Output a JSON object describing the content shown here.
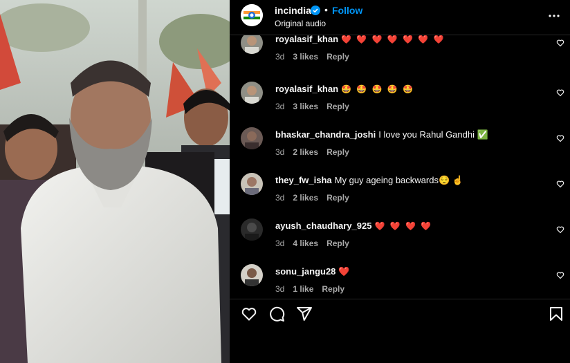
{
  "header": {
    "username": "incindia",
    "follow_label": "Follow",
    "separator": "•",
    "audio_label": "Original audio"
  },
  "comments": [
    {
      "username": "royalasif_khan",
      "text": "❤️ ❤️ ❤️ ❤️ ❤️ ❤️ ❤️",
      "time": "3d",
      "likes": "3 likes",
      "reply": "Reply"
    },
    {
      "username": "royalasif_khan",
      "text": "🤩 🤩 🤩 🤩 🤩",
      "time": "3d",
      "likes": "3 likes",
      "reply": "Reply"
    },
    {
      "username": "bhaskar_chandra_joshi",
      "text": "I love you Rahul Gandhi ✅",
      "time": "3d",
      "likes": "2 likes",
      "reply": "Reply"
    },
    {
      "username": "they_fw_isha",
      "text": "My guy ageing backwards😌 ☝️",
      "time": "3d",
      "likes": "2 likes",
      "reply": "Reply"
    },
    {
      "username": "ayush_chaudhary_925",
      "text": "❤️ ❤️ ❤️ ❤️",
      "time": "3d",
      "likes": "4 likes",
      "reply": "Reply"
    },
    {
      "username": "sonu_jangu28",
      "text": "❤️",
      "time": "3d",
      "likes": "1 like",
      "reply": "Reply"
    }
  ],
  "icons": {
    "verified": "verified-badge-icon",
    "more": "more-options-icon",
    "like": "heart-icon",
    "comment": "comment-icon",
    "share": "share-icon",
    "save": "bookmark-icon"
  },
  "colors": {
    "accent": "#0095f6",
    "heart": "#ff3040",
    "text": "#f5f5f5",
    "muted": "#a8a8a8",
    "background": "#000000"
  }
}
